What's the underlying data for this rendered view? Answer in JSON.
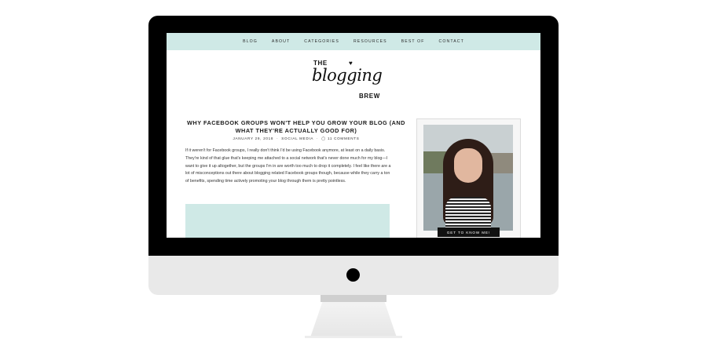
{
  "nav": {
    "items": [
      "BLOG",
      "ABOUT",
      "CATEGORIES",
      "RESOURCES",
      "BEST OF",
      "CONTACT"
    ]
  },
  "logo": {
    "the": "THE",
    "script": "blogging",
    "brew": "BREW"
  },
  "post": {
    "title": "WHY FACEBOOK GROUPS WON'T HELP YOU GROW YOUR BLOG (AND WHAT THEY'RE ACTUALLY GOOD FOR)",
    "date": "JANUARY 29, 2018",
    "category": "SOCIAL MEDIA",
    "comments": "11 COMMENTS",
    "body": "If it weren't for Facebook groups, I really don't think I'd be using Facebook anymore, at least on a daily basis. They're kind of that glue that's keeping me attached to a social network that's never done much for my blog—I want to give it up altogether, but the groups I'm in are worth too much to drop it completely. I feel like there are a lot of misconceptions out there about blogging related Facebook groups though, because while they carry a ton of benefits, spending time actively promoting your blog through them is pretty pointless."
  },
  "sidebar": {
    "button_label": "GET TO KNOW ME!"
  },
  "colors": {
    "accent": "#cfe9e6",
    "bezel": "#000000",
    "chin": "#e9e9e9"
  }
}
